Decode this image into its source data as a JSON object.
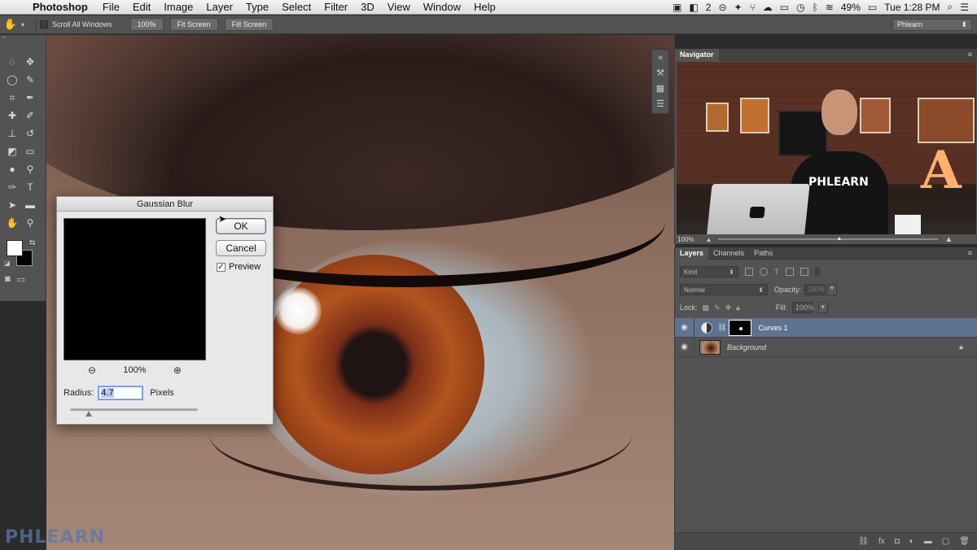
{
  "menubar": {
    "app_name": "Photoshop",
    "menus": [
      "File",
      "Edit",
      "Image",
      "Layer",
      "Type",
      "Select",
      "Filter",
      "3D",
      "View",
      "Window",
      "Help"
    ],
    "status_badge": "2",
    "battery": "49%",
    "clock": "Tue 1:28 PM",
    "user": "Phlearn"
  },
  "options_bar": {
    "scroll_all_label": "Scroll All Windows",
    "zoom_100": "100%",
    "fit_screen": "Fit Screen",
    "fill_screen": "Fill Screen",
    "workspace": "Phlearn"
  },
  "navigator": {
    "tab": "Navigator",
    "zoom": "100%",
    "shirt_text": "PHLEARN",
    "sign_letter": "A"
  },
  "layers_panel": {
    "tabs": [
      "Layers",
      "Channels",
      "Paths"
    ],
    "filter": "Kind",
    "blend_mode": "Normal",
    "opacity_label": "Opacity:",
    "opacity_value": "100%",
    "lock_label": "Lock:",
    "fill_label": "Fill:",
    "fill_value": "100%",
    "layers": [
      {
        "name": "Curves 1"
      },
      {
        "name": "Background"
      }
    ]
  },
  "dialog": {
    "title": "Gaussian Blur",
    "ok": "OK",
    "cancel": "Cancel",
    "preview_label": "Preview",
    "preview_checked": true,
    "zoom": "100%",
    "radius_label": "Radius:",
    "radius_value": "4.7",
    "units": "Pixels"
  },
  "watermark": "PHLEARN"
}
